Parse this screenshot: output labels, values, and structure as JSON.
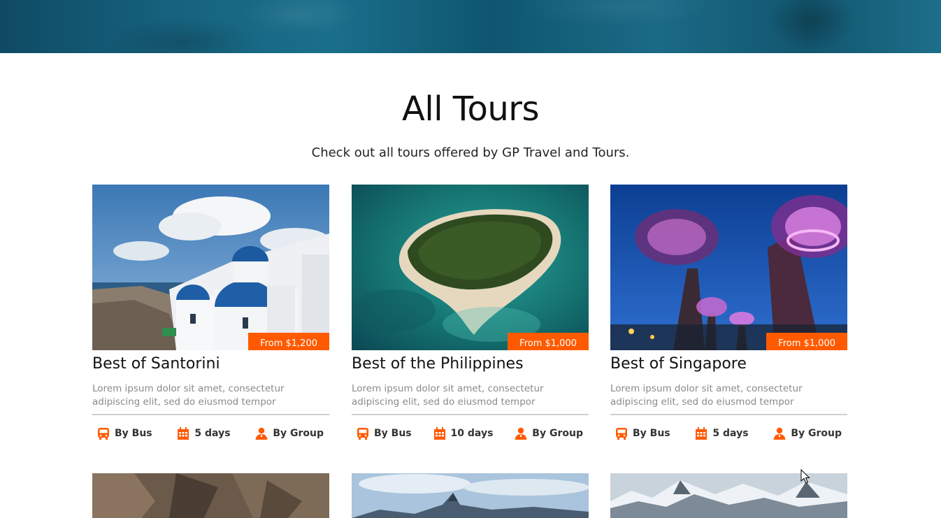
{
  "section": {
    "title": "All Tours",
    "subtitle": "Check out all tours offered by GP Travel and Tours."
  },
  "colors": {
    "accent": "#ff5a00",
    "hero": "#16627e",
    "text": "#111111",
    "muted": "#8a8a8a"
  },
  "tours": [
    {
      "title": "Best of Santorini",
      "price": "From $1,200",
      "description": "Lorem ipsum dolor sit amet, consectetur adipiscing elit, sed do eiusmod tempor",
      "transport": "By Bus",
      "duration": "5 days",
      "group": "By Group",
      "image": "santorini-photo"
    },
    {
      "title": "Best of the Philippines",
      "price": "From $1,000",
      "description": "Lorem ipsum dolor sit amet, consectetur adipiscing elit, sed do eiusmod tempor",
      "transport": "By Bus",
      "duration": "10 days",
      "group": "By Group",
      "image": "island-photo"
    },
    {
      "title": "Best of Singapore",
      "price": "From $1,000",
      "description": "Lorem ipsum dolor sit amet, consectetur adipiscing elit, sed do eiusmod tempor",
      "transport": "By Bus",
      "duration": "5 days",
      "group": "By Group",
      "image": "supertree-photo"
    }
  ],
  "icons": {
    "transport": "bus-icon",
    "duration": "calendar-icon",
    "group": "person-icon",
    "pointer": "mouse-cursor-icon"
  }
}
